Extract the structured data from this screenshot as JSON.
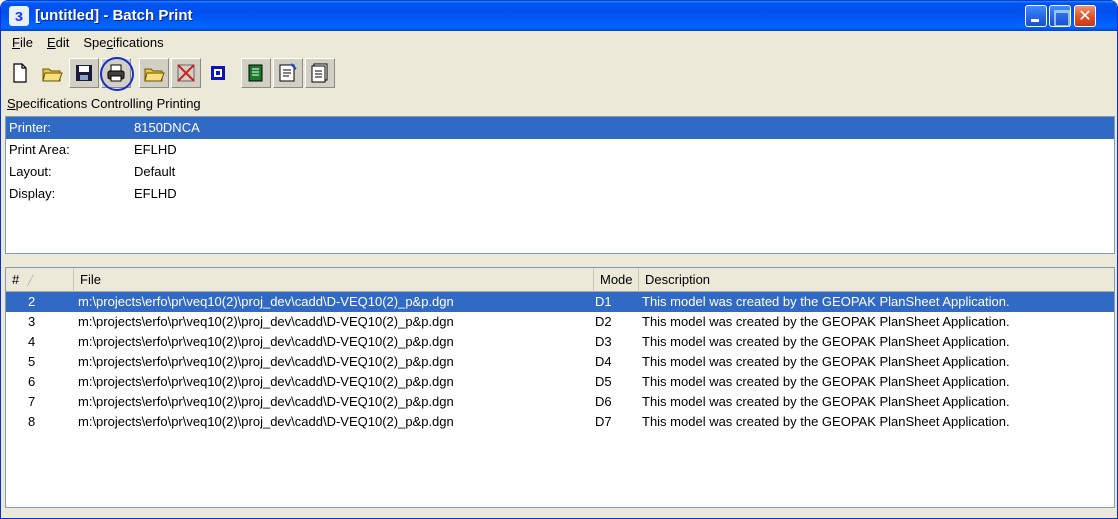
{
  "window": {
    "title": "[untitled] - Batch Print",
    "close_glyph": "✕"
  },
  "menu": {
    "file_u": "F",
    "file_rest": "ile",
    "edit_u": "E",
    "edit_rest": "dit",
    "spec_pre": "Spe",
    "spec_u": "c",
    "spec_rest": "ifications"
  },
  "toolbar": {
    "icons": [
      "new-document-icon",
      "open-folder-icon",
      "save-disk-icon",
      "print-icon",
      "open-spec-folder-icon",
      "delete-x-icon",
      "window-square-icon",
      "green-document-icon",
      "document-edit-icon",
      "document-list-icon"
    ]
  },
  "specs": {
    "label_u": "S",
    "label_rest": "pecifications Controlling Printing",
    "rows": [
      {
        "key": "Printer:",
        "value": "8150DNCA"
      },
      {
        "key": "Print Area:",
        "value": "EFLHD"
      },
      {
        "key": "Layout:",
        "value": "Default"
      },
      {
        "key": "Display:",
        "value": "EFLHD"
      }
    ]
  },
  "files": {
    "columns": {
      "num": "#",
      "file": "File",
      "mode": "Mode",
      "description": "Description"
    },
    "rows": [
      {
        "num": "2",
        "file": "m:\\projects\\erfo\\pr\\veq10(2)\\proj_dev\\cadd\\D-VEQ10(2)_p&p.dgn",
        "mode": "D1",
        "description": "This model was created by the GEOPAK PlanSheet Application."
      },
      {
        "num": "3",
        "file": "m:\\projects\\erfo\\pr\\veq10(2)\\proj_dev\\cadd\\D-VEQ10(2)_p&p.dgn",
        "mode": "D2",
        "description": "This model was created by the GEOPAK PlanSheet Application."
      },
      {
        "num": "4",
        "file": "m:\\projects\\erfo\\pr\\veq10(2)\\proj_dev\\cadd\\D-VEQ10(2)_p&p.dgn",
        "mode": "D3",
        "description": "This model was created by the GEOPAK PlanSheet Application."
      },
      {
        "num": "5",
        "file": "m:\\projects\\erfo\\pr\\veq10(2)\\proj_dev\\cadd\\D-VEQ10(2)_p&p.dgn",
        "mode": "D4",
        "description": "This model was created by the GEOPAK PlanSheet Application."
      },
      {
        "num": "6",
        "file": "m:\\projects\\erfo\\pr\\veq10(2)\\proj_dev\\cadd\\D-VEQ10(2)_p&p.dgn",
        "mode": "D5",
        "description": "This model was created by the GEOPAK PlanSheet Application."
      },
      {
        "num": "7",
        "file": "m:\\projects\\erfo\\pr\\veq10(2)\\proj_dev\\cadd\\D-VEQ10(2)_p&p.dgn",
        "mode": "D6",
        "description": "This model was created by the GEOPAK PlanSheet Application."
      },
      {
        "num": "8",
        "file": "m:\\projects\\erfo\\pr\\veq10(2)\\proj_dev\\cadd\\D-VEQ10(2)_p&p.dgn",
        "mode": "D7",
        "description": "This model was created by the GEOPAK PlanSheet Application."
      }
    ]
  },
  "colors": {
    "selection": "#316ac5",
    "titlebar": "#0053ee",
    "face": "#ece9d8"
  }
}
